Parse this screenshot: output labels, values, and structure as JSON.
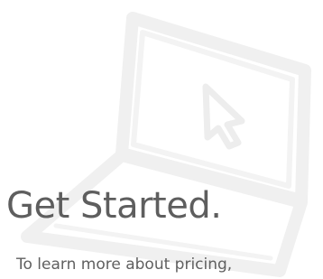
{
  "hero": {
    "illustration_icon": "laptop-with-cursor-icon",
    "headline": "Get Started.",
    "subtext": "To learn more about pricing,"
  },
  "colors": {
    "background": "#ffffff",
    "illustration": "#f4f4f4",
    "illustration_shadow": "#ececec",
    "text": "#5e5e5e"
  }
}
